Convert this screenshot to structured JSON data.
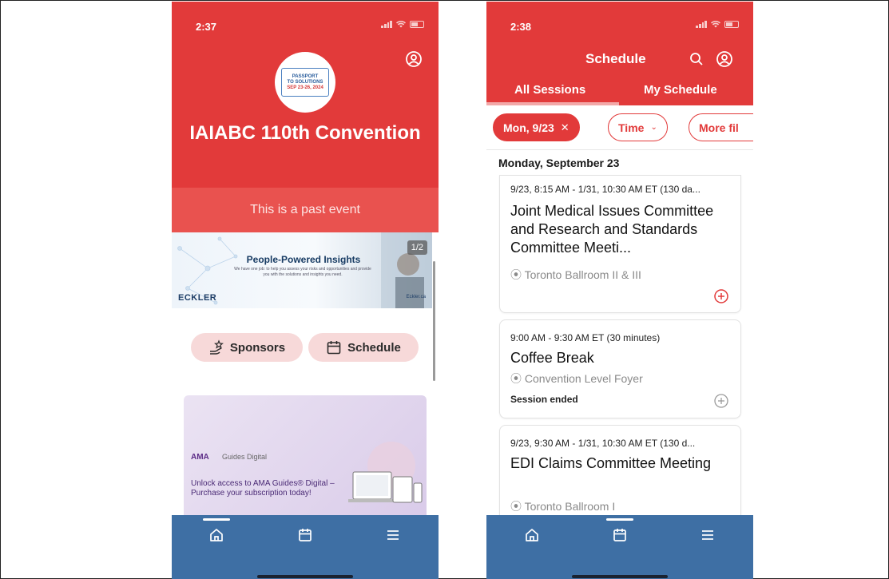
{
  "colors": {
    "brand_red": "#e23a3a",
    "tabbar_blue": "#3e6fa4",
    "pill_bg": "#f7d9d9"
  },
  "home_screen": {
    "status_time": "2:37",
    "event_logo": {
      "line1": "PASSPORT",
      "line2": "TO SOLUTIONS",
      "dates": "SEP 23-26, 2024"
    },
    "event_title": "IAIABC 110th Convention",
    "past_event_banner": "This is a past event",
    "carousel": {
      "counter": "1/2",
      "headline": "People-Powered Insights",
      "subtext": "We have one job: to help you assess your risks and opportunities and provide you with the solutions and insights you need.",
      "brand": "ECKLER",
      "url": "Eckler.ca"
    },
    "buttons": {
      "sponsors": "Sponsors",
      "schedule": "Schedule"
    },
    "ama_ad": {
      "logo": "AMA",
      "product": "Guides Digital",
      "message": "Unlock access to AMA Guides® Digital – Purchase your subscription today!"
    },
    "tabbar": {
      "icons": [
        "home-icon",
        "calendar-icon",
        "menu-icon"
      ],
      "active": "home"
    }
  },
  "schedule_screen": {
    "status_time": "2:38",
    "title": "Schedule",
    "tabs": [
      "All Sessions",
      "My Schedule"
    ],
    "active_tab": "All Sessions",
    "filters": {
      "date": "Mon, 9/23",
      "time": "Time",
      "more": "More fil"
    },
    "day_header": "Monday, September 23",
    "sessions": [
      {
        "time": "9/23, 8:15 AM - 1/31, 10:30 AM ET (130 da...",
        "title": "Joint Medical Issues Committee and Research and Standards Committee Meeti...",
        "location": "Toronto Ballroom II & III",
        "status": ""
      },
      {
        "time": "9:00 AM - 9:30 AM ET (30 minutes)",
        "title": "Coffee Break",
        "location": "Convention Level Foyer",
        "status": "Session ended"
      },
      {
        "time": "9/23, 9:30 AM - 1/31, 10:30 AM ET (130 d...",
        "title": "EDI Claims Committee Meeting",
        "location": "Toronto Ballroom I",
        "status": ""
      }
    ],
    "tabbar": {
      "icons": [
        "home-icon",
        "calendar-icon",
        "menu-icon"
      ],
      "active": "calendar"
    }
  }
}
